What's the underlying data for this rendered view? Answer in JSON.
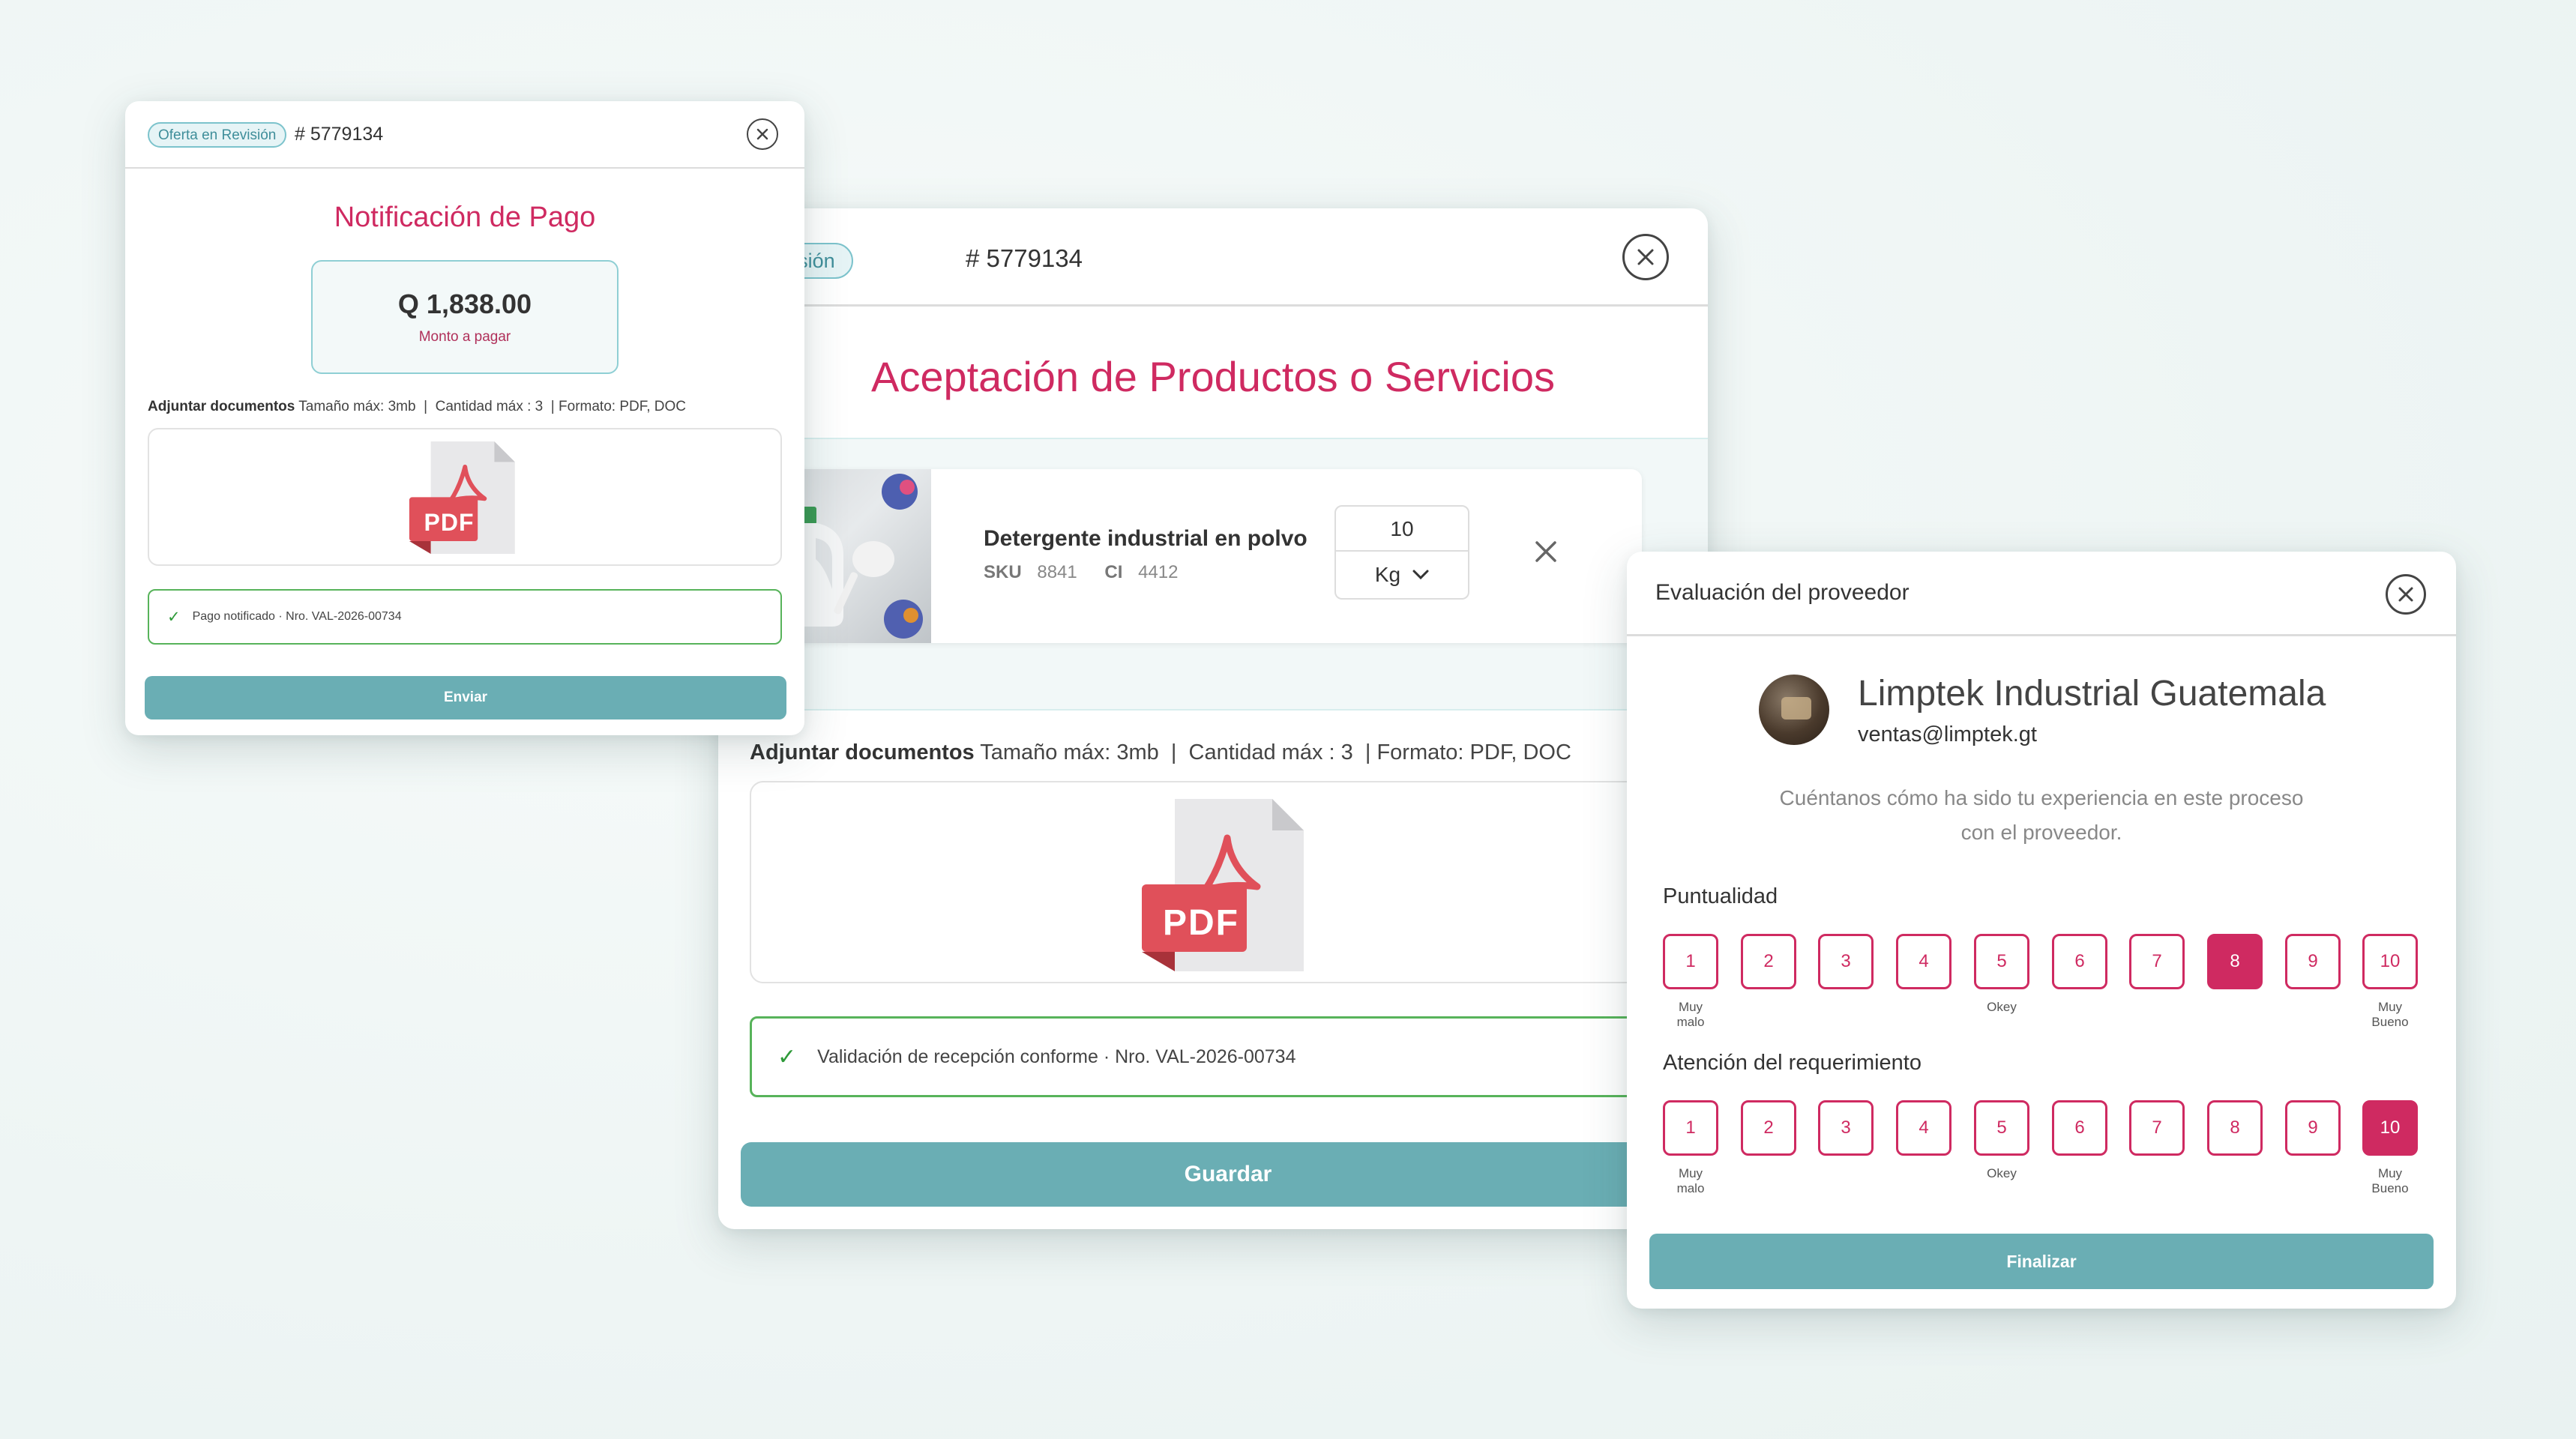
{
  "payment_modal": {
    "badge": "Oferta en Revisión",
    "order_number": "# 5779134",
    "title": "Notificación de Pago",
    "amount": "Q 1,838.00",
    "amount_caption": "Monto a pagar",
    "attach_label": "Adjuntar documentos",
    "attach_rules": "Tamaño máx: 3mb  |  Cantidad máx : 3  | Formato: PDF, DOC",
    "file_icon": "pdf-file-icon",
    "file_label": "PDF",
    "success_text": "Pago notificado · Nro. VAL-2026-00734",
    "submit_label": "Enviar"
  },
  "acceptance_modal": {
    "badge": "Oferta en Revisión",
    "order_number": "# 5779134",
    "title": "Aceptación de Productos o Servicios",
    "product": {
      "name": "Detergente industrial en polvo",
      "sku_label": "SKU",
      "sku_value": "8841",
      "ci_label": "CI",
      "ci_value": "4412",
      "quantity": "10",
      "unit": "Kg"
    },
    "attach_label": "Adjuntar documentos",
    "attach_rules": "Tamaño máx: 3mb  |  Cantidad máx : 3  | Formato: PDF, DOC",
    "file_label": "PDF",
    "success_text": "Validación de recepción conforme · Nro. VAL-2026-00734",
    "save_label": "Guardar"
  },
  "evaluation_modal": {
    "header_title": "Evaluación del proveedor",
    "provider_name": "Limptek Industrial Guatemala",
    "provider_email": "ventas@limptek.gt",
    "prompt_line1": "Cuéntanos cómo ha sido tu experiencia en este proceso",
    "prompt_line2": "con el proveedor.",
    "criteria": [
      {
        "label": "Puntualidad",
        "selected": 8
      },
      {
        "label": "Atención del requerimiento",
        "selected": 10
      }
    ],
    "scale": [
      "1",
      "2",
      "3",
      "4",
      "5",
      "6",
      "7",
      "8",
      "9",
      "10"
    ],
    "caption_low": "Muy malo",
    "caption_mid": "Okey",
    "caption_high": "Muy Bueno",
    "finish_label": "Finalizar"
  },
  "colors": {
    "accent_pink": "#cf2a61",
    "teal_button": "#6aaeb4",
    "success_green": "#57b35a",
    "badge_teal": "#7cc3cc"
  }
}
